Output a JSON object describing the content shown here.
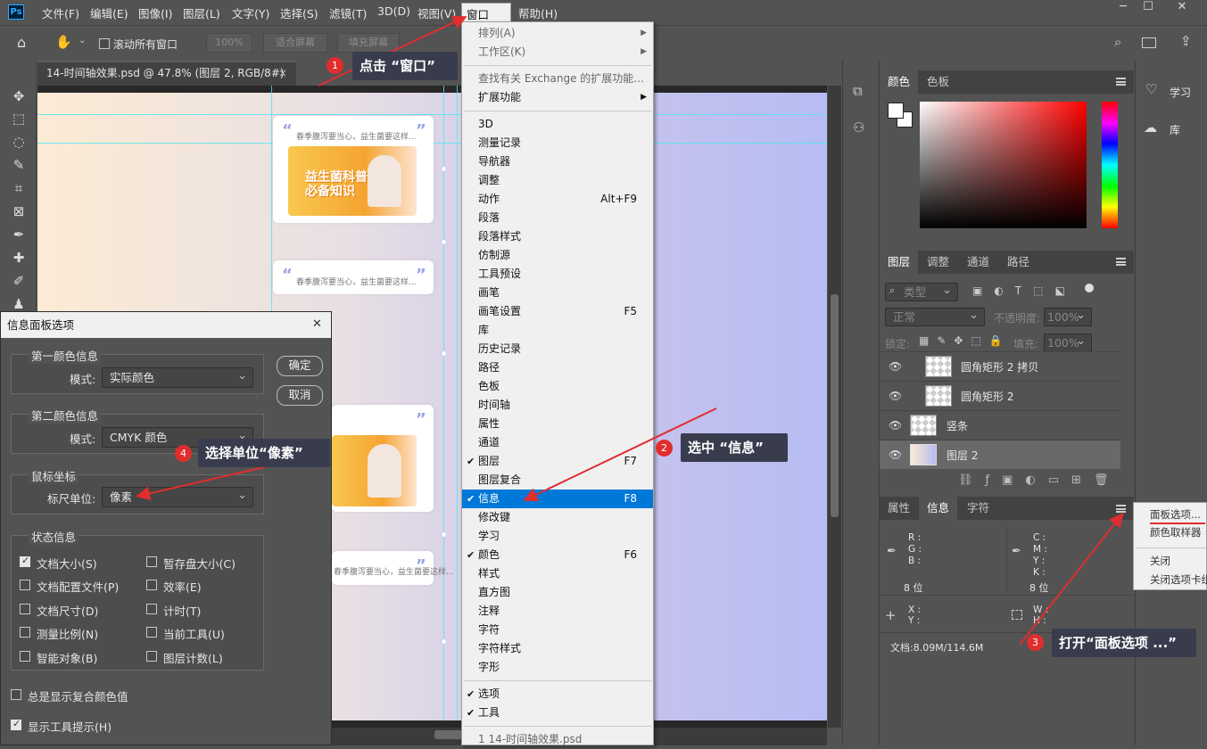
{
  "app": {
    "logo": "Ps"
  },
  "menubar": {
    "items": [
      "文件(F)",
      "编辑(E)",
      "图像(I)",
      "图层(L)",
      "文字(Y)",
      "选择(S)",
      "滤镜(T)",
      "3D(D)",
      "视图(V)",
      "窗口(W)",
      "帮助(H)"
    ]
  },
  "window_controls": {
    "minimize": "─",
    "maximize": "☐",
    "close": "✕"
  },
  "options_bar": {
    "scroll_all": "滚动所有窗口",
    "zoom": "100%",
    "fit_screen": "适合屏幕",
    "fill_screen": "填充屏幕"
  },
  "document_tab": {
    "title": "14-时间轴效果.psd @ 47.8% (图层 2, RGB/8#)",
    "close": "×"
  },
  "canvas": {
    "card_text": "春季腹泻要当心，益生菌要这样...",
    "thumb_title_line1": "益生菌科普",
    "thumb_title_line2": "必备知识",
    "quote_open": "“",
    "quote_close": "”"
  },
  "window_menu": {
    "items": [
      {
        "label": "排列(A)",
        "dim": true,
        "arrow": true
      },
      {
        "label": "工作区(K)",
        "dim": true,
        "arrow": true
      },
      {
        "sep": true
      },
      {
        "label": "查找有关 Exchange 的扩展功能...",
        "dim": true
      },
      {
        "label": "扩展功能",
        "arrow": true
      },
      {
        "sep": true
      },
      {
        "label": "3D"
      },
      {
        "label": "测量记录"
      },
      {
        "label": "导航器"
      },
      {
        "label": "调整"
      },
      {
        "label": "动作",
        "shortcut": "Alt+F9"
      },
      {
        "label": "段落"
      },
      {
        "label": "段落样式"
      },
      {
        "label": "仿制源"
      },
      {
        "label": "工具预设"
      },
      {
        "label": "画笔"
      },
      {
        "label": "画笔设置",
        "shortcut": "F5"
      },
      {
        "label": "库"
      },
      {
        "label": "历史记录"
      },
      {
        "label": "路径"
      },
      {
        "label": "色板"
      },
      {
        "label": "时间轴"
      },
      {
        "label": "属性"
      },
      {
        "label": "通道"
      },
      {
        "label": "图层",
        "shortcut": "F7",
        "checked": true
      },
      {
        "label": "图层复合"
      },
      {
        "label": "信息",
        "shortcut": "F8",
        "checked": true,
        "selected": true
      },
      {
        "label": "修改键"
      },
      {
        "label": "学习"
      },
      {
        "label": "颜色",
        "shortcut": "F6",
        "checked": true
      },
      {
        "label": "样式"
      },
      {
        "label": "直方图"
      },
      {
        "label": "注释"
      },
      {
        "label": "字符"
      },
      {
        "label": "字符样式"
      },
      {
        "label": "字形"
      },
      {
        "sep": true
      },
      {
        "label": "选项",
        "checked": true
      },
      {
        "label": "工具",
        "checked": true
      },
      {
        "sep": true
      },
      {
        "label": "1 14-时间轴效果.psd",
        "dim": true
      }
    ]
  },
  "color_panel": {
    "tabs": [
      "颜色",
      "色板"
    ]
  },
  "layers_panel": {
    "tabs": [
      "图层",
      "调整",
      "通道",
      "路径"
    ],
    "filter": "类型",
    "blend": "正常",
    "opacity_label": "不透明度:",
    "opacity": "100%",
    "lock_label": "锁定:",
    "fill_label": "填充:",
    "fill": "100%",
    "layers": [
      "圆角矩形 2 拷贝",
      "圆角矩形 2",
      "竖条",
      "图层 2"
    ]
  },
  "info_panel": {
    "tabs": [
      "属性",
      "信息",
      "字符"
    ],
    "rgb": [
      "R :",
      "G :",
      "B :"
    ],
    "cmyk": [
      "C :",
      "M :",
      "Y :",
      "K :"
    ],
    "bit1": "8 位",
    "bit2": "8 位",
    "xy": [
      "X :",
      "Y :"
    ],
    "wh": [
      "W :",
      "H :"
    ],
    "doc": "文档:8.09M/114.6M"
  },
  "far_panel": {
    "learn": "学习",
    "library": "库"
  },
  "context_menu": {
    "items": [
      "面板选项...",
      "颜色取样器",
      "关闭",
      "关闭选项卡组"
    ]
  },
  "dialog": {
    "title": "信息面板选项",
    "close": "✕",
    "ok": "确定",
    "cancel": "取消",
    "first_color": {
      "group": "第一颜色信息",
      "mode_label": "模式:",
      "mode": "实际颜色"
    },
    "second_color": {
      "group": "第二颜色信息",
      "mode_label": "模式:",
      "mode": "CMYK 颜色"
    },
    "mouse": {
      "group": "鼠标坐标",
      "unit_label": "标尺单位:",
      "unit": "像素"
    },
    "status": {
      "group": "状态信息",
      "left": [
        {
          "label": "文档大小(S)",
          "on": true
        },
        {
          "label": "文档配置文件(P)",
          "on": false
        },
        {
          "label": "文档尺寸(D)",
          "on": false
        },
        {
          "label": "测量比例(N)",
          "on": false
        },
        {
          "label": "智能对象(B)",
          "on": false
        }
      ],
      "right": [
        {
          "label": "暂存盘大小(C)",
          "on": false
        },
        {
          "label": "效率(E)",
          "on": false
        },
        {
          "label": "计时(T)",
          "on": false
        },
        {
          "label": "当前工具(U)",
          "on": false
        },
        {
          "label": "图层计数(L)",
          "on": false
        }
      ]
    },
    "always_composite": {
      "label": "总是显示复合颜色值",
      "on": false
    },
    "show_tooltips": {
      "label": "显示工具提示(H)",
      "on": true
    }
  },
  "annotations": [
    {
      "num": "1",
      "text": "点击 “窗口”"
    },
    {
      "num": "2",
      "text": "选中 “信息”"
    },
    {
      "num": "3",
      "text": "打开“面板选项 ...”"
    },
    {
      "num": "4",
      "text": "选择单位“像素”"
    }
  ],
  "colors": {
    "accent": "#0078d7",
    "callout_bg": "#393c4d",
    "badge": "#e02d2d",
    "arrow": "#e02d2d"
  }
}
